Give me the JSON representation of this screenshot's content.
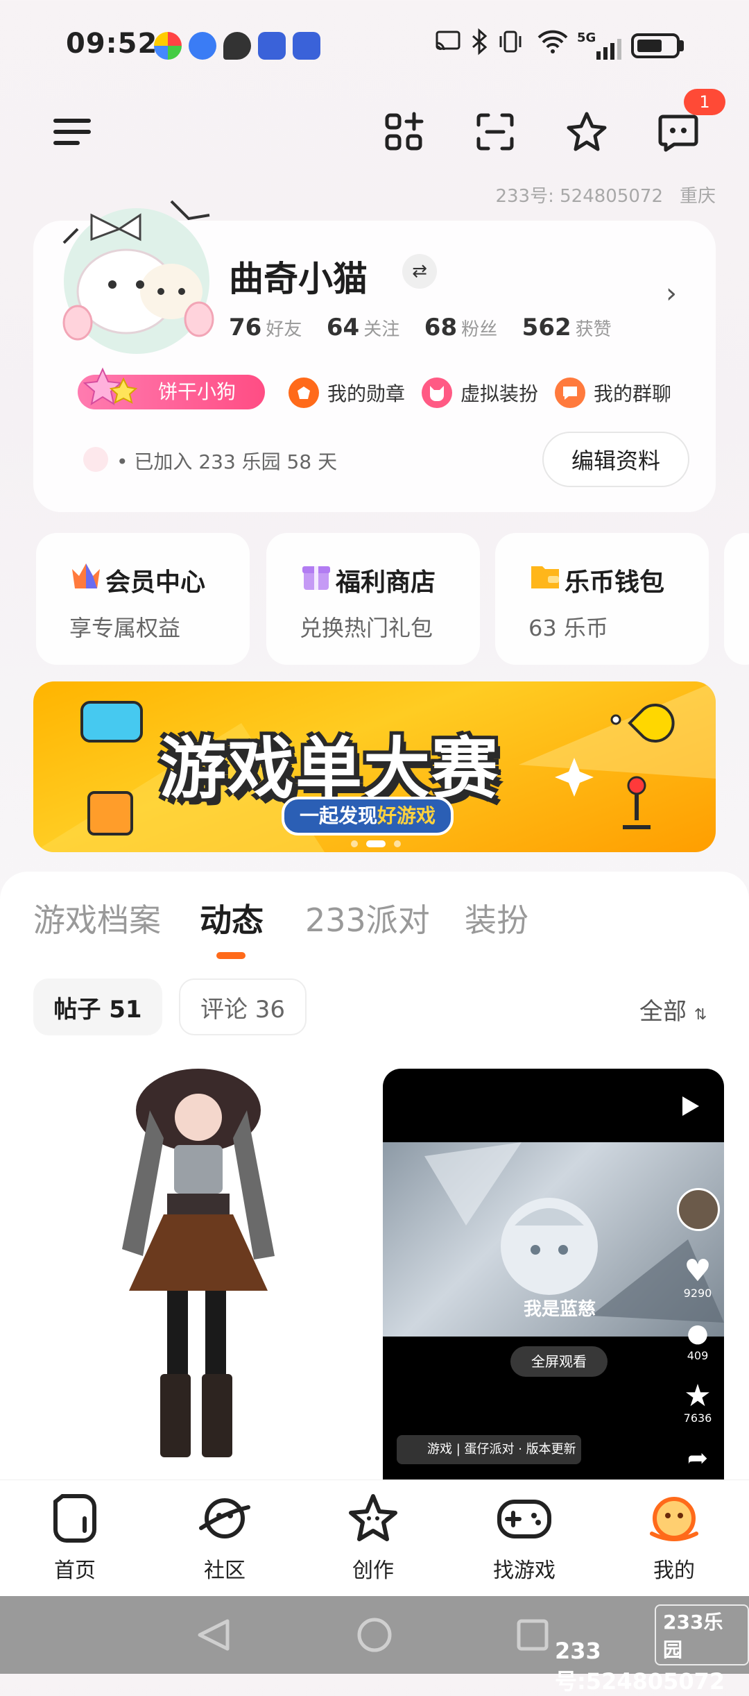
{
  "status_bar": {
    "time": "09:52",
    "network": "5G"
  },
  "top_nav": {
    "notification_count": "1"
  },
  "account": {
    "id_label": "233号: 524805072",
    "city": "重庆"
  },
  "profile": {
    "name": "曲奇小猫",
    "stats": [
      {
        "value": "76",
        "label": "好友"
      },
      {
        "value": "64",
        "label": "关注"
      },
      {
        "value": "68",
        "label": "粉丝"
      },
      {
        "value": "562",
        "label": "获赞"
      }
    ],
    "tag": "饼干小狗",
    "chips": [
      "我的勋章",
      "虚拟装扮",
      "我的群聊"
    ],
    "joined": "• 已加入 233 乐园 58 天",
    "edit_button": "编辑资料"
  },
  "shortcuts": [
    {
      "title": "会员中心",
      "subtitle": "享专属权益"
    },
    {
      "title": "福利商店",
      "subtitle": "兑换热门礼包"
    },
    {
      "title": "乐币钱包",
      "subtitle": "63 乐币"
    }
  ],
  "banner": {
    "title": "游戏单大赛",
    "subtitle_a": "一起发现",
    "subtitle_b": "好游戏"
  },
  "tabs": [
    "游戏档案",
    "动态",
    "233派对",
    "装扮"
  ],
  "active_tab": "动态",
  "segments": {
    "posts": "帖子 51",
    "comments": "评论 36",
    "filter": "全部"
  },
  "video_card": {
    "caption": "我是蓝慈",
    "fullscreen": "全屏观看",
    "likes": "9290",
    "comments": "409",
    "favorites": "7636",
    "game_tag": "游戏 | 蛋仔派对 · 版本更新"
  },
  "bottom_nav": [
    "首页",
    "社区",
    "创作",
    "找游戏",
    "我的"
  ],
  "watermark": {
    "brand": "233乐园",
    "id": "233号:524805072"
  },
  "colors": {
    "accent": "#ff6a1a",
    "badge": "#ff4a36",
    "pill": "#ff4d84"
  }
}
